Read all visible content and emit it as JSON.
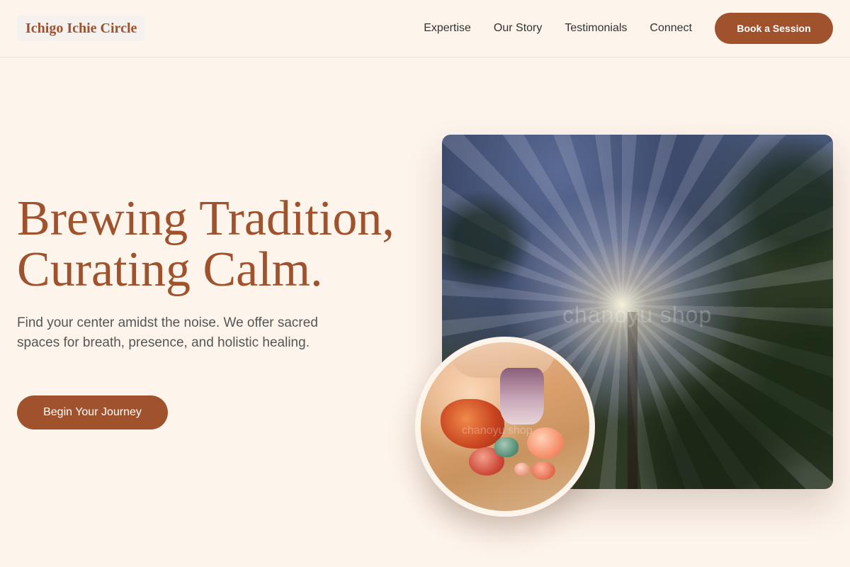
{
  "header": {
    "logo": "Ichigo Ichie Circle",
    "nav": [
      "Expertise",
      "Our Story",
      "Testimonials",
      "Connect"
    ],
    "cta": "Book a Session"
  },
  "hero": {
    "title_line1": "Brewing Tradition,",
    "title_line2": "Curating Calm.",
    "subtitle": "Find your center amidst the noise. We offer sacred spaces for breath, presence, and holistic healing.",
    "cta": "Begin Your Journey"
  },
  "images": {
    "forest_watermark": "chanoyu shop",
    "crystal_watermark": "chanoyu shop"
  },
  "colors": {
    "accent": "#a0522d",
    "background": "#fdf4ec",
    "text_muted": "#555555"
  },
  "icons": []
}
